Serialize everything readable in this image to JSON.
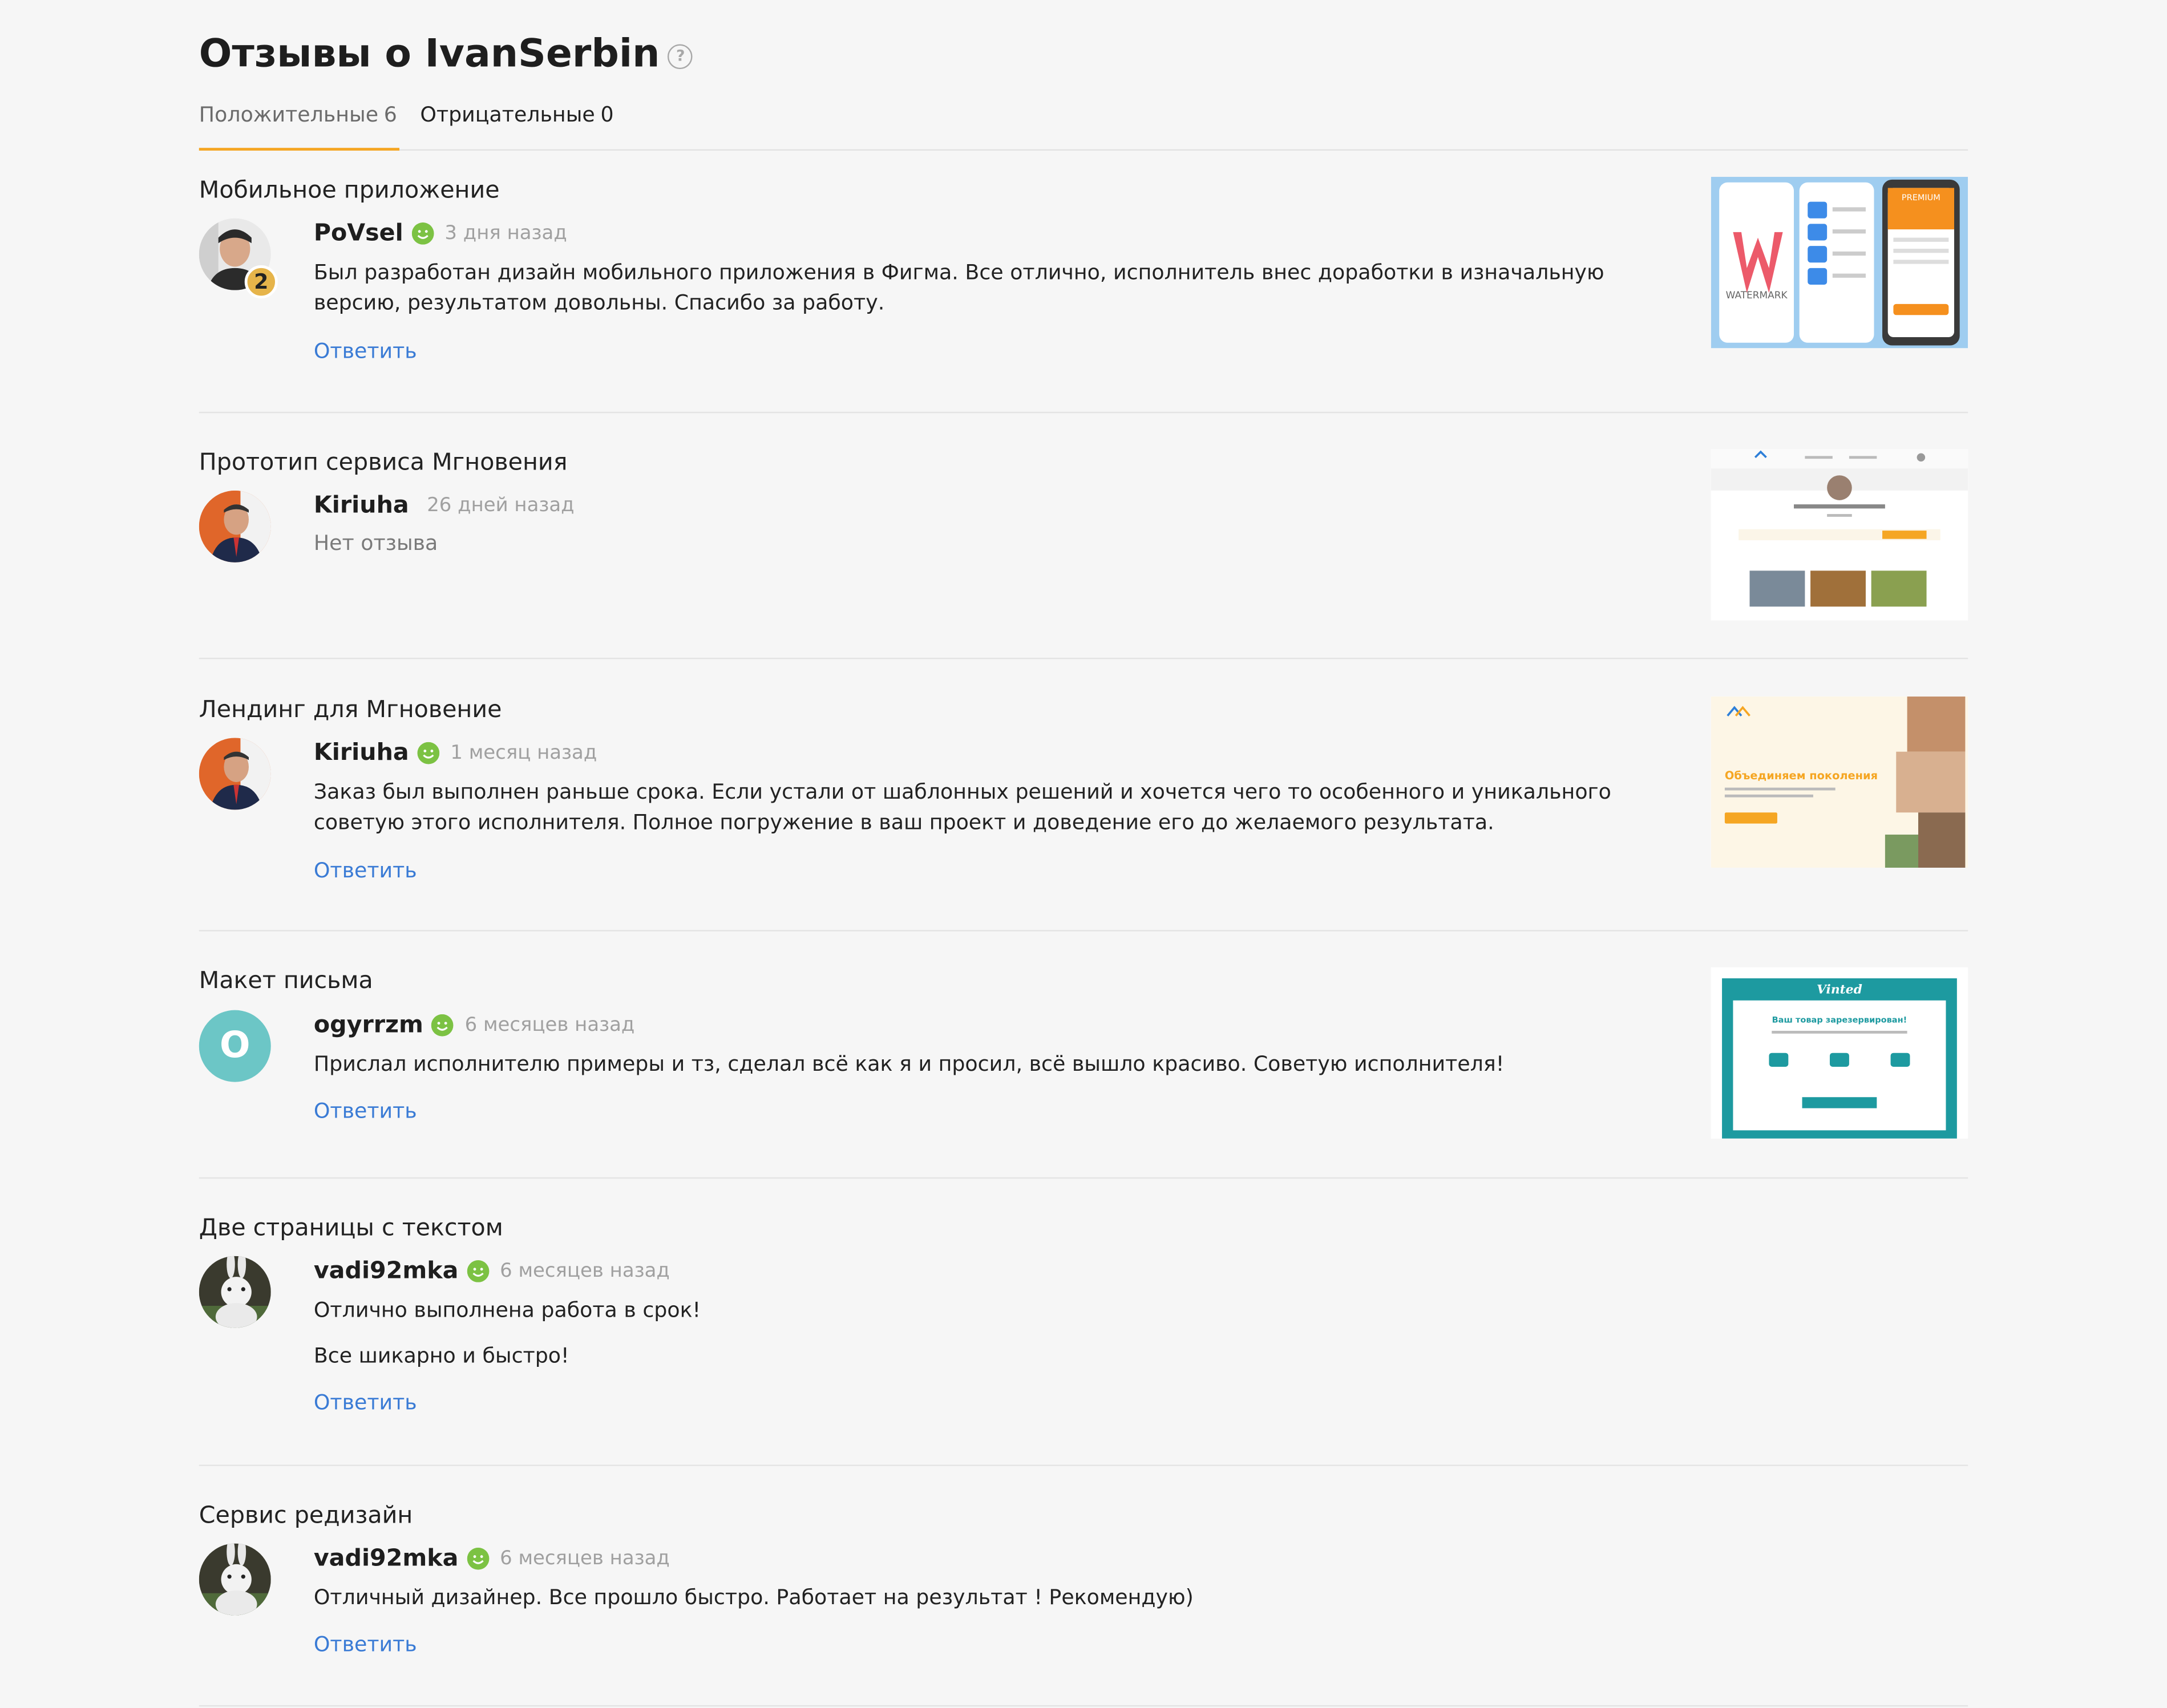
{
  "page": {
    "title": "Отзывы о IvanSerbin",
    "help_icon": "?"
  },
  "tabs": [
    {
      "label": "Положительные",
      "count": "6",
      "active": true
    },
    {
      "label": "Отрицательные",
      "count": "0",
      "active": false
    }
  ],
  "reviews": [
    {
      "project": "Мобильное приложение",
      "author": "PoVsel",
      "level_badge": "2",
      "time": "3 дня назад",
      "text": "Был разработан дизайн мобильного приложения в Фигма. Все отлично, исполнитель внес доработки в изначальную версию, результатом довольны. Спасибо за работу.",
      "reply": "Ответить",
      "thumb_watermark": "WATERMARK",
      "thumb_premium": "PREMIUM"
    },
    {
      "project": "Прототип сервиса Мгновения",
      "author": "Kiriuha",
      "time": "26 дней назад",
      "text": "Нет отзыва"
    },
    {
      "project": "Лендинг для Мгновение",
      "author": "Kiriuha",
      "time": "1 месяц назад",
      "text": "Заказ был выполнен раньше срока. Если устали от шаблонных решений и хочется чего то особенного и уникального советую этого исполнителя. Полное погружение в ваш проект и доведение его до желаемого результата.",
      "reply": "Ответить",
      "thumb_heading": "Объединяем поколения"
    },
    {
      "project": "Макет письма",
      "author": "ogyrrzm",
      "avatar_letter": "O",
      "time": "6 месяцев назад",
      "text": "Прислал исполнителю примеры и тз, сделал всё как я и просил, всё вышло красиво. Советую исполнителя!",
      "reply": "Ответить",
      "thumb_brand": "Vinted",
      "thumb_heading": "Ваш товар зарезервирован!"
    },
    {
      "project": "Две страницы с текстом",
      "author": "vadi92mka",
      "time": "6 месяцев назад",
      "text": "Отлично выполнена работа в срок!",
      "text2": "Все шикарно и быстро!",
      "reply": "Ответить"
    },
    {
      "project": "Сервис редизайн",
      "author": "vadi92mka",
      "time": "6 месяцев назад",
      "text": "Отличный дизайнер. Все прошло быстро. Работает на результат ! Рекомендую)",
      "reply": "Ответить"
    }
  ],
  "colors": {
    "accent_tab": "#f5a623",
    "link": "#3a7bd5",
    "positive_smile": "#7cc243",
    "background": "#f6f6f6"
  }
}
